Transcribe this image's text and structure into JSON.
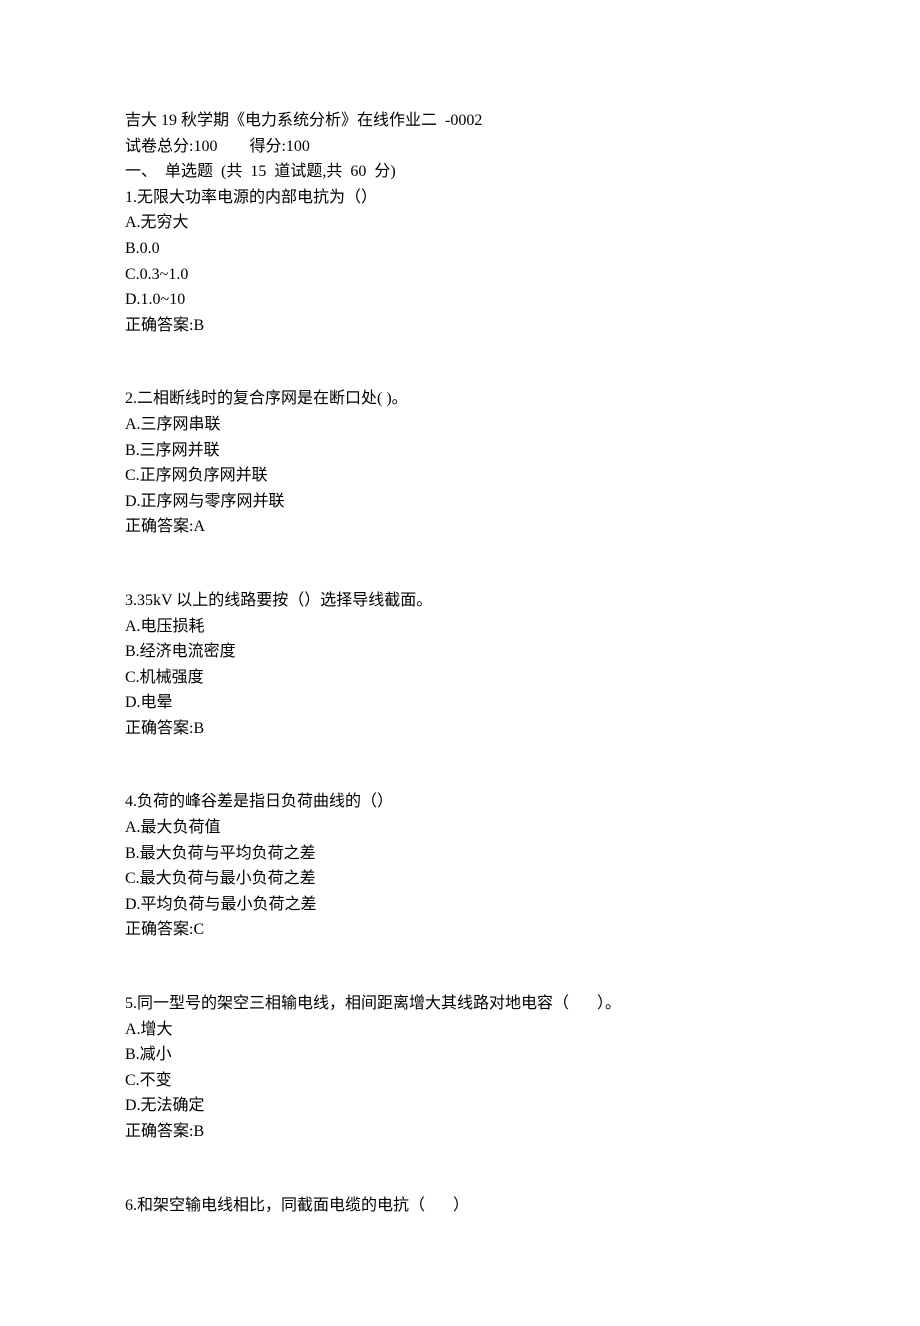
{
  "header": {
    "title": "吉大 19 秋学期《电力系统分析》在线作业二  -0002",
    "totalLabel": "试卷总分:100",
    "scoreLabel": "得分:100",
    "sectionTitle": "一、  单选题  (共  15  道试题,共  60  分)"
  },
  "questions": [
    {
      "stem": "1.无限大功率电源的内部电抗为（）",
      "options": [
        "A.无穷大",
        "B.0.0",
        "C.0.3~1.0",
        "D.1.0~10"
      ],
      "answer": "正确答案:B"
    },
    {
      "stem": "2.二相断线时的复合序网是在断口处( )。",
      "options": [
        "A.三序网串联",
        "B.三序网并联",
        "C.正序网负序网并联",
        "D.正序网与零序网并联"
      ],
      "answer": "正确答案:A"
    },
    {
      "stem": "3.35kV 以上的线路要按（）选择导线截面。",
      "options": [
        "A.电压损耗",
        "B.经济电流密度",
        "C.机械强度",
        "D.电晕"
      ],
      "answer": "正确答案:B"
    },
    {
      "stem": "4.负荷的峰谷差是指日负荷曲线的（）",
      "options": [
        "A.最大负荷值",
        "B.最大负荷与平均负荷之差",
        "C.最大负荷与最小负荷之差",
        "D.平均负荷与最小负荷之差"
      ],
      "answer": "正确答案:C"
    },
    {
      "stem": "5.同一型号的架空三相输电线，相间距离增大其线路对地电容（       ）。",
      "options": [
        "A.增大",
        "B.减小",
        "C.不变",
        "D.无法确定"
      ],
      "answer": "正确答案:B"
    },
    {
      "stem": "6.和架空输电线相比，同截面电缆的电抗（       ）",
      "options": [],
      "answer": ""
    }
  ]
}
